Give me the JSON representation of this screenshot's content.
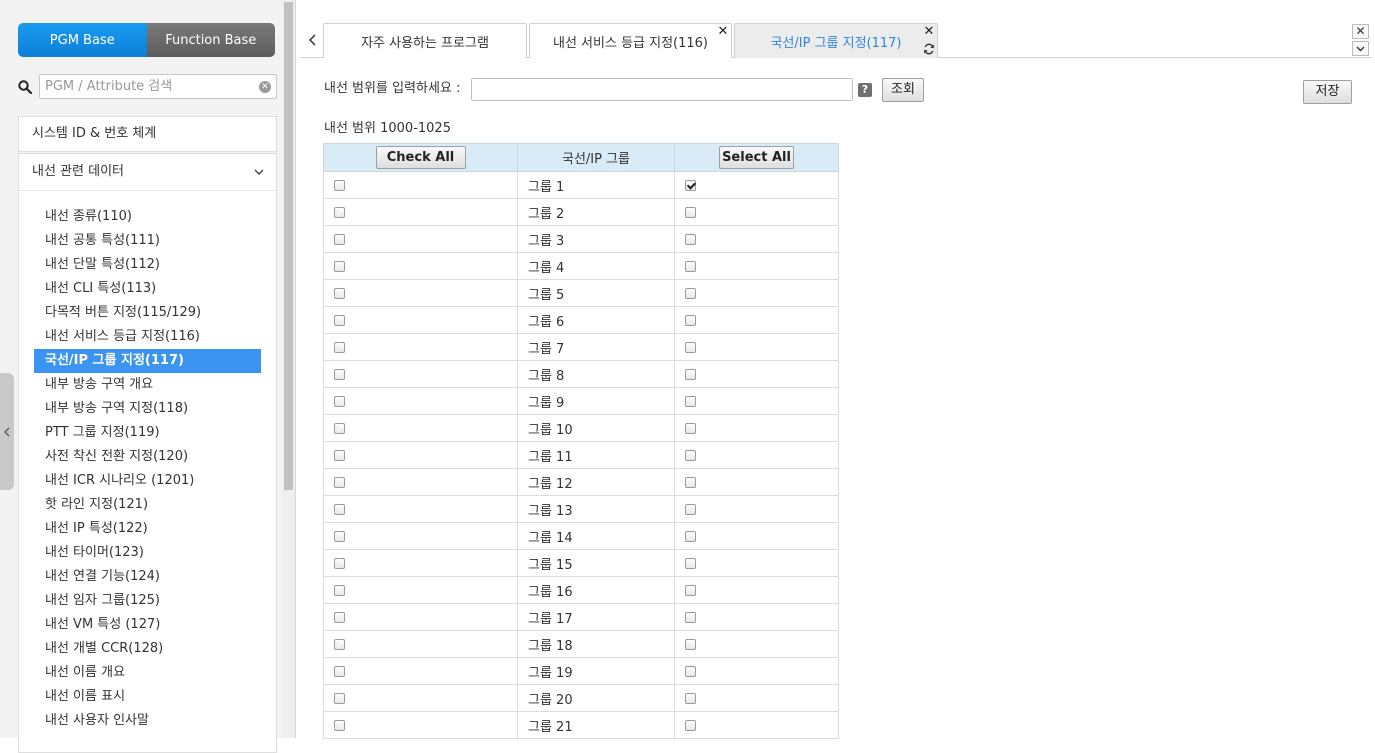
{
  "sidebar": {
    "base_tabs": {
      "pgm": "PGM Base",
      "function": "Function Base"
    },
    "search": {
      "placeholder": "PGM / Attribute 검색",
      "value": ""
    },
    "category_system": "시스템 ID & 번호 체계",
    "category_ext": "내선 관련 데이터",
    "items": [
      "내선 종류(110)",
      "내선 공통 특성(111)",
      "내선 단말 특성(112)",
      "내선 CLI 특성(113)",
      "다목적 버튼 지정(115/129)",
      "내선 서비스 등급 지정(116)",
      "국선/IP 그룹 지정(117)",
      "내부 방송 구역 개요",
      "내부 방송 구역 지정(118)",
      "PTT 그룹 지정(119)",
      "사전 착신 전환 지정(120)",
      "내선 ICR 시나리오 (1201)",
      "핫 라인 지정(121)",
      "내선 IP 특성(122)",
      "내선 타이머(123)",
      "내선 연결 기능(124)",
      "내선 임자 그룹(125)",
      "내선 VM 특성 (127)",
      "내선 개별 CCR(128)",
      "내선 이름 개요",
      "내선 이름 표시",
      "내선 사용자 인사말"
    ],
    "active_index": 6
  },
  "tabs": [
    {
      "label": "자주 사용하는 프로그램"
    },
    {
      "label": "내선 서비스 등급 지정(116)"
    },
    {
      "label": "국선/IP 그룹 지정(117)"
    }
  ],
  "form": {
    "range_label": "내선 범위를 입력하세요 :",
    "range_value": "",
    "help": "?",
    "query_label": "조회",
    "save_label": "저장",
    "range_info": "내선 범위 1000-1025"
  },
  "table": {
    "check_all_label": "Check All",
    "group_header": "국선/IP 그룹",
    "select_all_label": "Select All",
    "rows": [
      {
        "group": "그룹 1",
        "left": false,
        "right": true
      },
      {
        "group": "그룹 2",
        "left": false,
        "right": false
      },
      {
        "group": "그룹 3",
        "left": false,
        "right": false
      },
      {
        "group": "그룹 4",
        "left": false,
        "right": false
      },
      {
        "group": "그룹 5",
        "left": false,
        "right": false
      },
      {
        "group": "그룹 6",
        "left": false,
        "right": false
      },
      {
        "group": "그룹 7",
        "left": false,
        "right": false
      },
      {
        "group": "그룹 8",
        "left": false,
        "right": false
      },
      {
        "group": "그룹 9",
        "left": false,
        "right": false
      },
      {
        "group": "그룹 10",
        "left": false,
        "right": false
      },
      {
        "group": "그룹 11",
        "left": false,
        "right": false
      },
      {
        "group": "그룹 12",
        "left": false,
        "right": false
      },
      {
        "group": "그룹 13",
        "left": false,
        "right": false
      },
      {
        "group": "그룹 14",
        "left": false,
        "right": false
      },
      {
        "group": "그룹 15",
        "left": false,
        "right": false
      },
      {
        "group": "그룹 16",
        "left": false,
        "right": false
      },
      {
        "group": "그룹 17",
        "left": false,
        "right": false
      },
      {
        "group": "그룹 18",
        "left": false,
        "right": false
      },
      {
        "group": "그룹 19",
        "left": false,
        "right": false
      },
      {
        "group": "그룹 20",
        "left": false,
        "right": false
      },
      {
        "group": "그룹 21",
        "left": false,
        "right": false
      }
    ]
  },
  "colors": {
    "accent": "#3b94f0",
    "pgm_base": "#0c7fd6",
    "function_base": "#5c5c5c",
    "table_header": "#d9ebf6",
    "active_tab_text": "#2f86e0"
  }
}
